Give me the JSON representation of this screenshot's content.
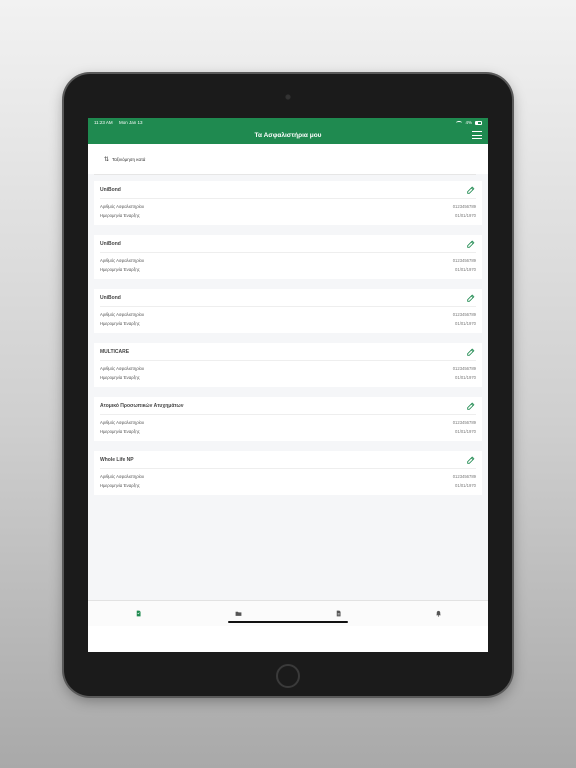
{
  "status": {
    "time": "11:23 AM",
    "date": "Mon Jan 13",
    "battery": "4%"
  },
  "header": {
    "title": "Τα Ασφαλιστήρια μου"
  },
  "sort": {
    "label": "Ταξινόμηση κατά"
  },
  "policies": [
    {
      "name": "UniBond",
      "number_label": "Αριθμός Ασφαλιστηρίου",
      "number": "0123456789",
      "date_label": "Ημερομηνία Έναρξης",
      "date": "01/01/1970"
    },
    {
      "name": "UniBond",
      "number_label": "Αριθμός Ασφαλιστηρίου",
      "number": "0123456789",
      "date_label": "Ημερομηνία Έναρξης",
      "date": "01/01/1970"
    },
    {
      "name": "UniBond",
      "number_label": "Αριθμός Ασφαλιστηρίου",
      "number": "0123456789",
      "date_label": "Ημερομηνία Έναρξης",
      "date": "01/01/1970"
    },
    {
      "name": "MULTICARE",
      "number_label": "Αριθμός Ασφαλιστηρίου",
      "number": "0123456789",
      "date_label": "Ημερομηνία Έναρξης",
      "date": "01/01/1970"
    },
    {
      "name": "Ατομικό Προσωπικών Ατυχημάτων",
      "number_label": "Αριθμός Ασφαλιστηρίου",
      "number": "0123456789",
      "date_label": "Ημερομηνία Έναρξης",
      "date": "01/01/1970"
    },
    {
      "name": "Whole Life NP",
      "number_label": "Αριθμός Ασφαλιστηρίου",
      "number": "0123456789",
      "date_label": "Ημερομηνία Έναρξης",
      "date": "01/01/1970"
    }
  ],
  "tabs": [
    {
      "icon": "policy-document-icon",
      "active": true
    },
    {
      "icon": "folder-icon",
      "active": false
    },
    {
      "icon": "file-icon",
      "active": false
    },
    {
      "icon": "bell-icon",
      "active": false
    }
  ],
  "colors": {
    "brand": "#1f8a50",
    "background": "#f5f6f8",
    "inactive_tab": "#555555"
  }
}
